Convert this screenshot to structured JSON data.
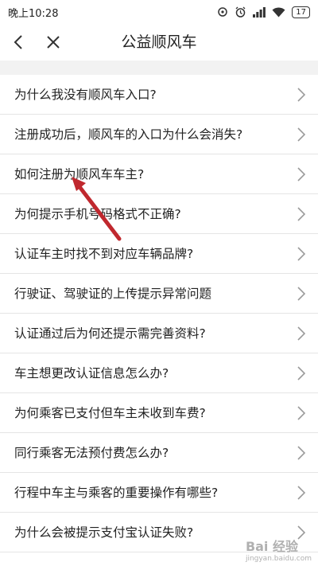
{
  "status_bar": {
    "time": "晚上10:28",
    "battery": "17",
    "icons": [
      "circle-icon",
      "alarm-icon",
      "signal-icon",
      "wifi-icon",
      "battery-icon"
    ]
  },
  "header": {
    "title": "公益顺风车",
    "back_icon": "chevron-left-icon",
    "close_icon": "close-icon"
  },
  "list": {
    "items": [
      {
        "label": "为什么我没有顺风车入口?"
      },
      {
        "label": "注册成功后，顺风车的入口为什么会消失?"
      },
      {
        "label": "如何注册为顺风车车主?"
      },
      {
        "label": "为何提示手机号码格式不正确?"
      },
      {
        "label": "认证车主时找不到对应车辆品牌?"
      },
      {
        "label": "行驶证、驾驶证的上传提示异常问题"
      },
      {
        "label": "认证通过后为何还提示需完善资料?"
      },
      {
        "label": "车主想更改认证信息怎么办?"
      },
      {
        "label": "为何乘客已支付但车主未收到车费?"
      },
      {
        "label": "同行乘客无法预付费怎么办?"
      },
      {
        "label": "行程中车主与乘客的重要操作有哪些?"
      },
      {
        "label": "为什么会被提示支付宝认证失败?"
      }
    ]
  },
  "annotation": {
    "color": "#c0282e"
  },
  "watermark": {
    "text": "Bai 经验",
    "subtext": "jingyan.baidu.com"
  }
}
